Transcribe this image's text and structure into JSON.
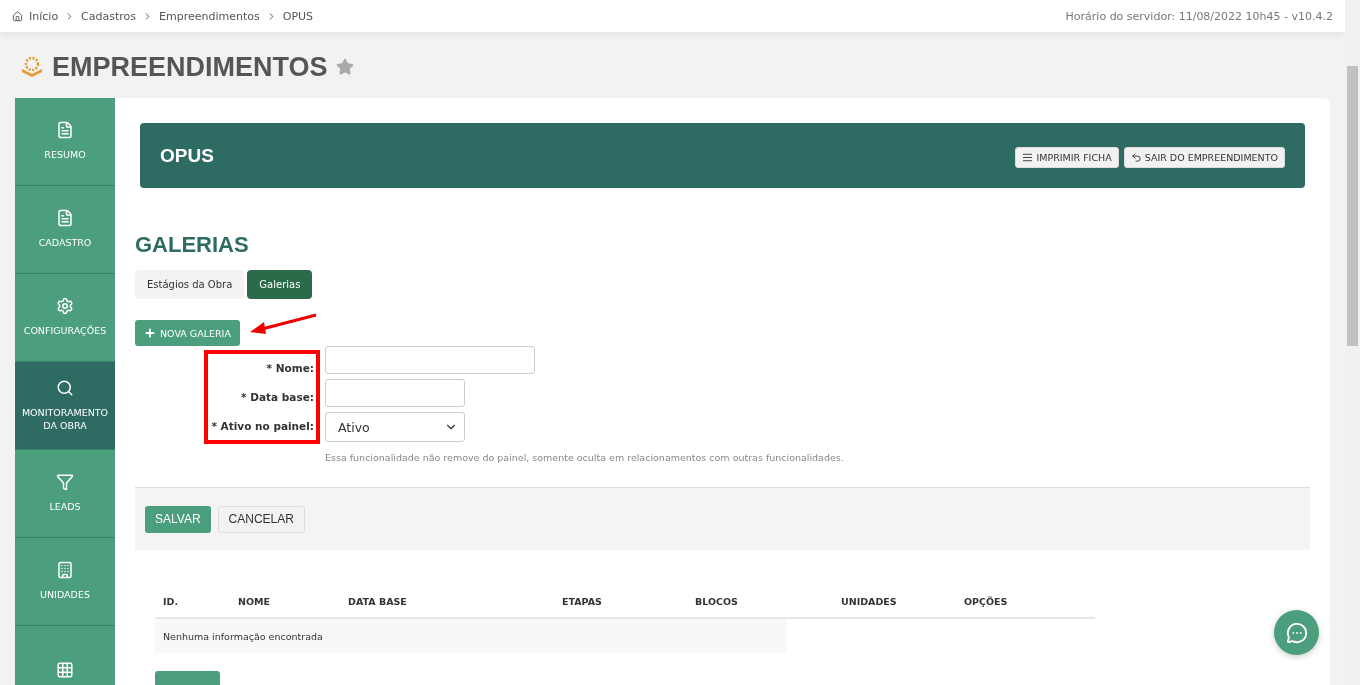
{
  "breadcrumb": [
    "Início",
    "Cadastros",
    "Empreendimentos",
    "OPUS"
  ],
  "server_info": "Horário do servidor: 11/08/2022 10h45 - v10.4.2",
  "page_title": "EMPREENDIMENTOS",
  "favorite": false,
  "sidebar": {
    "items": [
      {
        "label": "RESUMO",
        "selected": false
      },
      {
        "label": "CADASTRO",
        "selected": false
      },
      {
        "label": "CONFIGURAÇÕES",
        "selected": false
      },
      {
        "label": "MONITORAMENTO DA OBRA",
        "selected": true
      },
      {
        "label": "LEADS",
        "selected": false
      },
      {
        "label": "UNIDADES",
        "selected": false
      },
      {
        "selected": false
      }
    ]
  },
  "header": {
    "title": "OPUS",
    "buttons": [
      "IMPRIMIR FICHA",
      "SAIR DO EMPREENDIMENTO"
    ]
  },
  "section_title": "GALERIAS",
  "tabs": [
    {
      "label": "Estágios da Obra",
      "selected": false
    },
    {
      "label": "Galerias",
      "selected": true
    }
  ],
  "new_button": "NOVA GALERIA",
  "form": {
    "fields": [
      {
        "kind": "text",
        "label": "* Nome:"
      },
      {
        "kind": "date",
        "label": "* Data base:"
      },
      {
        "kind": "select",
        "label": "* Ativo no painel:",
        "value": "Ativo"
      }
    ],
    "help": "Essa funcionalidade não remove do painel, somente oculta em relacionamentos com outras funcionalidades."
  },
  "actions": [
    {
      "label": "SALVAR",
      "kind": "primary"
    },
    {
      "label": "CANCELAR",
      "kind": "secondary"
    }
  ],
  "table": {
    "columns": [
      "ID.",
      "NOME",
      "DATA BASE",
      "ETAPAS",
      "BLOCOS",
      "UNIDADES",
      "OPÇÕES"
    ],
    "empty_message": "Nenhuma informação encontrada"
  }
}
